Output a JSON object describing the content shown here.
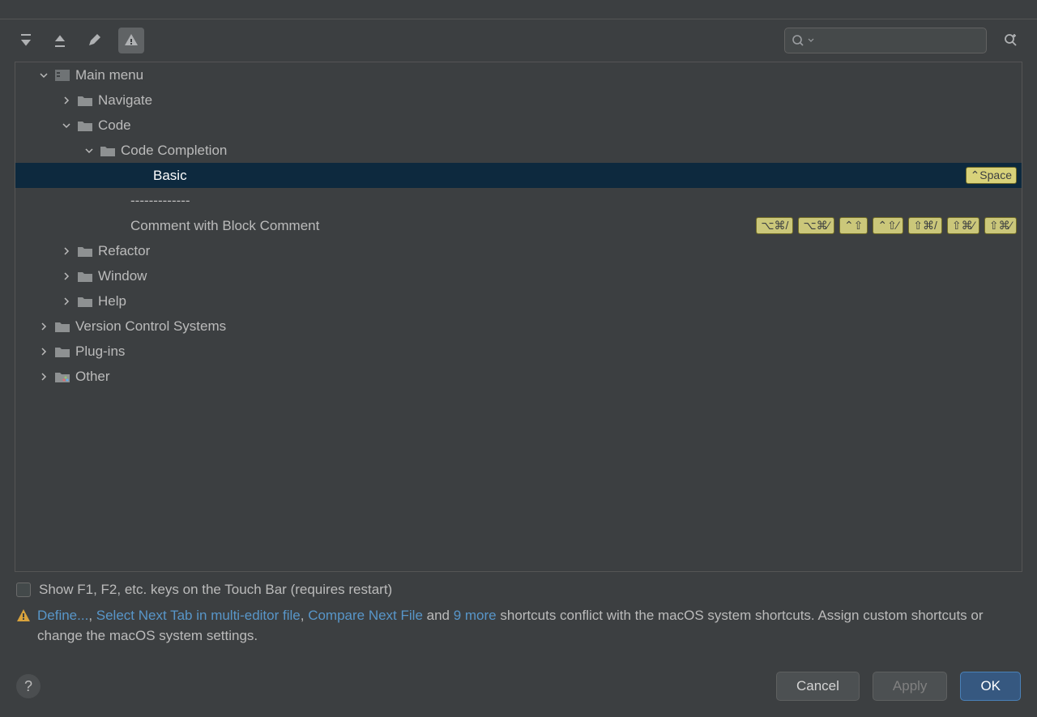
{
  "toolbar": {
    "search_placeholder": ""
  },
  "tree": {
    "main_menu": "Main menu",
    "navigate": "Navigate",
    "code": "Code",
    "code_completion": "Code Completion",
    "basic": "Basic",
    "basic_shortcut": "⌃Space",
    "separator": "-------------",
    "comment_block": "Comment with Block Comment",
    "comment_shortcuts": [
      "⌥⌘/",
      "⌥⌘⁄",
      "⌃⇧",
      "⌃⇧⁄",
      "⇧⌘/",
      "⇧⌘⁄",
      "⇧⌘⁄"
    ],
    "refactor": "Refactor",
    "window": "Window",
    "help": "Help",
    "vcs": "Version Control Systems",
    "plugins": "Plug-ins",
    "other": "Other"
  },
  "checkbox_label": "Show F1, F2, etc. keys on the Touch Bar (requires restart)",
  "conflict": {
    "define": "Define...",
    "comma1": ", ",
    "select_next": "Select Next Tab in multi-editor file",
    "comma2": ", ",
    "compare_next": "Compare Next File",
    "and": " and ",
    "more": "9 more",
    "tail": " shortcuts conflict with the macOS system shortcuts. Assign custom shortcuts or change the macOS system settings."
  },
  "buttons": {
    "cancel": "Cancel",
    "apply": "Apply",
    "ok": "OK"
  }
}
